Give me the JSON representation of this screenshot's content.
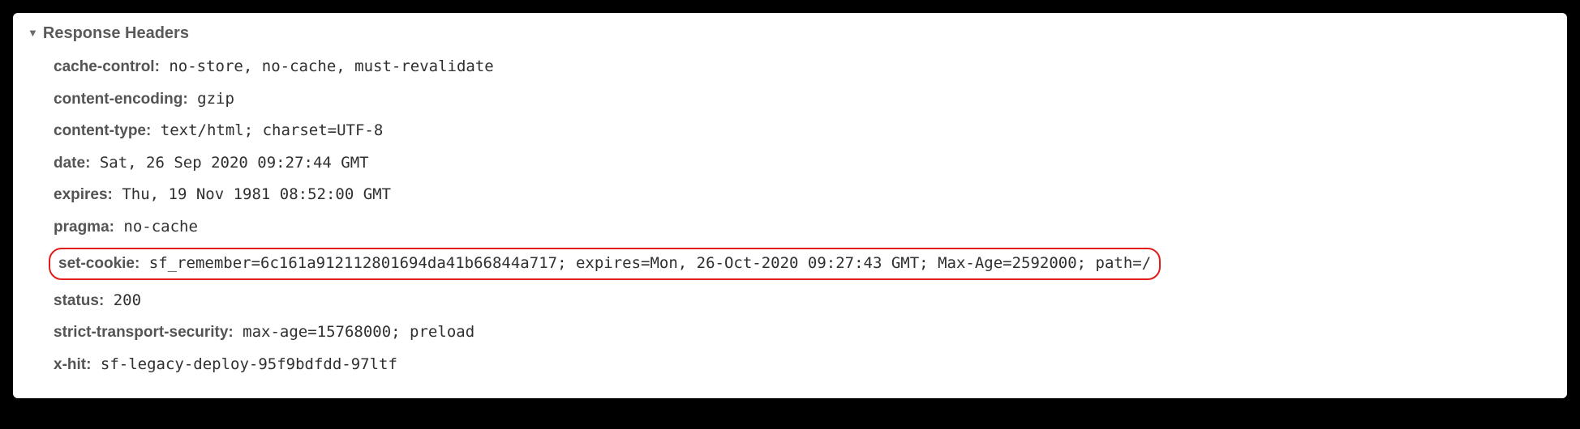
{
  "section_title": "Response Headers",
  "headers": [
    {
      "name": "cache-control:",
      "value": "no-store, no-cache, must-revalidate",
      "highlighted": false
    },
    {
      "name": "content-encoding:",
      "value": "gzip",
      "highlighted": false
    },
    {
      "name": "content-type:",
      "value": "text/html; charset=UTF-8",
      "highlighted": false
    },
    {
      "name": "date:",
      "value": "Sat, 26 Sep 2020 09:27:44 GMT",
      "highlighted": false
    },
    {
      "name": "expires:",
      "value": "Thu, 19 Nov 1981 08:52:00 GMT",
      "highlighted": false
    },
    {
      "name": "pragma:",
      "value": "no-cache",
      "highlighted": false
    },
    {
      "name": "set-cookie:",
      "value": "sf_remember=6c161a912112801694da41b66844a717; expires=Mon, 26-Oct-2020 09:27:43 GMT; Max-Age=2592000; path=/",
      "highlighted": true
    },
    {
      "name": "status:",
      "value": "200",
      "highlighted": false
    },
    {
      "name": "strict-transport-security:",
      "value": "max-age=15768000; preload",
      "highlighted": false
    },
    {
      "name": "x-hit:",
      "value": "sf-legacy-deploy-95f9bdfdd-97ltf",
      "highlighted": false
    }
  ]
}
